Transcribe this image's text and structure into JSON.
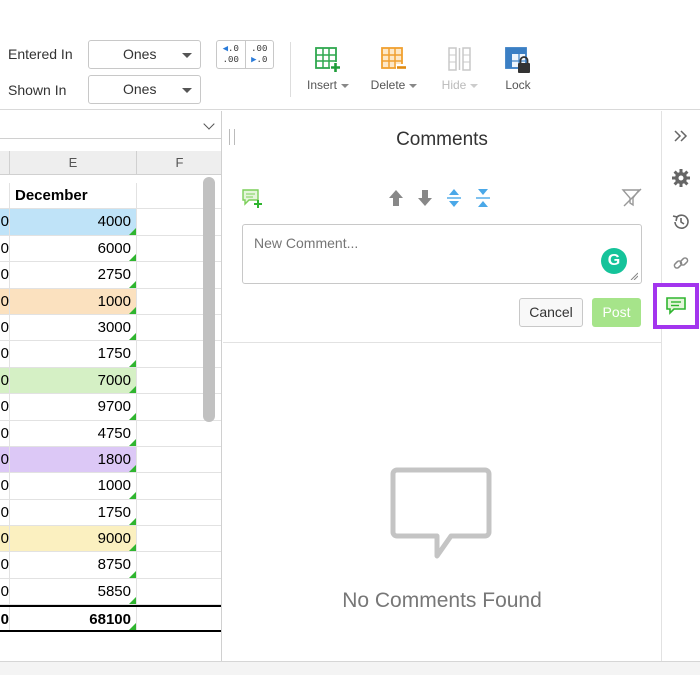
{
  "toolbar": {
    "entered_in": {
      "label": "Entered In",
      "value": "Ones"
    },
    "shown_in": {
      "label": "Shown In",
      "value": "Ones"
    },
    "decimals": {
      "increase": ".0 / .00",
      "decrease": ".00 / .0"
    },
    "tools": [
      {
        "label": "Insert",
        "icon": "insert-icon",
        "enabled": true
      },
      {
        "label": "Delete",
        "icon": "delete-icon",
        "enabled": true
      },
      {
        "label": "Hide",
        "icon": "hide-icon",
        "enabled": false
      },
      {
        "label": "Lock",
        "icon": "lock-icon",
        "enabled": true
      }
    ]
  },
  "sheet": {
    "columns": [
      "E",
      "F"
    ],
    "header": "December",
    "rows": [
      {
        "d": "0",
        "e": "4000",
        "color": "#bfe3f8"
      },
      {
        "d": "0",
        "e": "6000",
        "color": ""
      },
      {
        "d": "0",
        "e": "2750",
        "color": ""
      },
      {
        "d": "0",
        "e": "1000",
        "color": "#fbe1bf"
      },
      {
        "d": "0",
        "e": "3000",
        "color": ""
      },
      {
        "d": "0",
        "e": "1750",
        "color": ""
      },
      {
        "d": "0",
        "e": "7000",
        "color": "#d5f0c5"
      },
      {
        "d": "0",
        "e": "9700",
        "color": ""
      },
      {
        "d": "0",
        "e": "4750",
        "color": ""
      },
      {
        "d": "0",
        "e": "1800",
        "color": "#dcc8f6"
      },
      {
        "d": "0",
        "e": "1000",
        "color": ""
      },
      {
        "d": "0",
        "e": "1750",
        "color": ""
      },
      {
        "d": "0",
        "e": "9000",
        "color": "#fbf0c0"
      },
      {
        "d": "0",
        "e": "8750",
        "color": ""
      },
      {
        "d": "0",
        "e": "5850",
        "color": ""
      }
    ],
    "total": {
      "d": "0",
      "e": "68100"
    }
  },
  "comments": {
    "title": "Comments",
    "input_placeholder": "New Comment...",
    "cancel_label": "Cancel",
    "post_label": "Post",
    "empty_message": "No Comments Found",
    "tools": [
      "add-comment-icon",
      "arrow-up-icon",
      "arrow-down-icon",
      "expand-icon",
      "collapse-icon",
      "filter-icon"
    ]
  },
  "rail": {
    "items": [
      "collapse-panel-icon",
      "settings-icon",
      "history-icon",
      "link-icon",
      "comments-icon"
    ],
    "active": "comments-icon"
  },
  "colors": {
    "accent_green": "#2fb52f",
    "post_button": "#a6e48a",
    "active_outline": "#a335ee",
    "blue_arrows": "#2a7bd9"
  }
}
